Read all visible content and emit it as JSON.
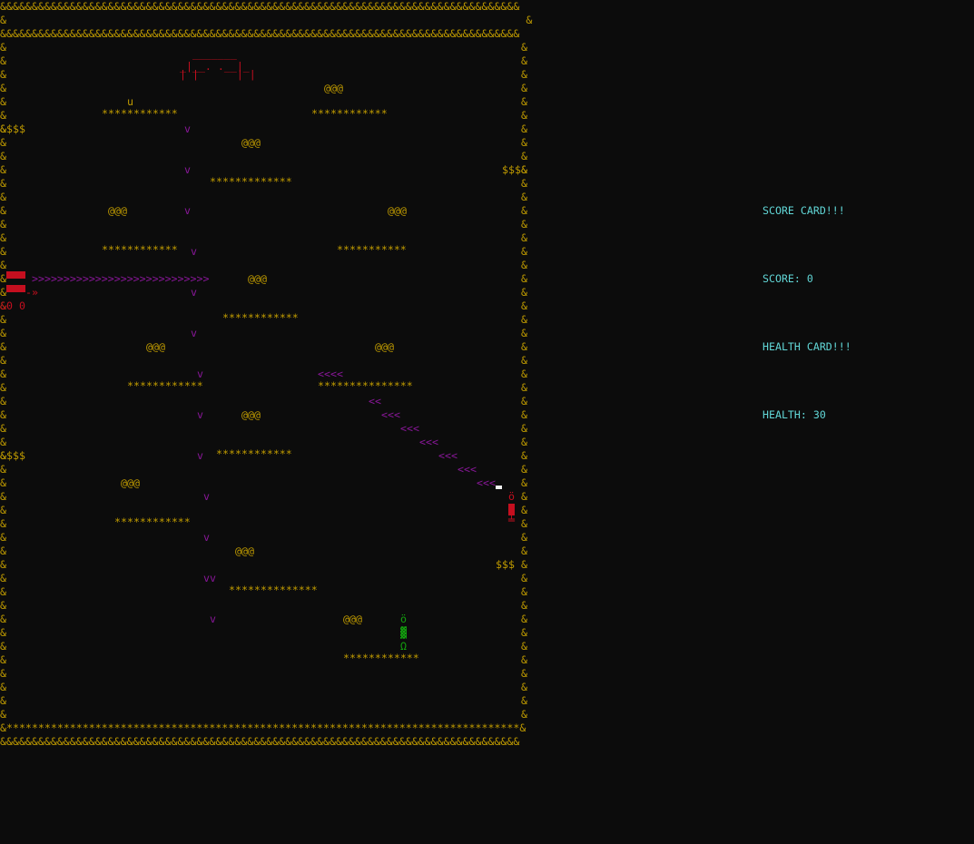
{
  "board": {
    "border_top_1": "&&&&&&&&&&&&&&&&&&&&&&&&&&&&&&&&&&&&&&&&&&&&&&&&&&&&&&&&&&&&&&&&&&&&&&&&&&&&&&&&&&",
    "border_top_2": "&                                                                                  &",
    "border_top_3": "&&&&&&&&&&&&&&&&&&&&&&&&&&&&&&&&&&&&&&&&&&&&&&&&&&&&&&&&&&&&&&&&&&&&&&&&&&&&&&&&&&",
    "floor": "&*********************************************************************************&",
    "border_bottom": "&&&&&&&&&&&&&&&&&&&&&&&&&&&&&&&&&&&&&&&&&&&&&&&&&&&&&&&&&&&&&&&&&&&&&&&&&&&&&&&&&&",
    "side": "&",
    "boss_art": [
      "  _______",
      "_|__. .__|_",
      "| |      | |"
    ],
    "player_u": "u",
    "coin": "@@@",
    "money": "$$$",
    "money_left": "&$$$",
    "money_right": "$$$&",
    "money_mid": "$$$",
    "platform_12": "************",
    "platform_13": "*************",
    "platform_11": "***********",
    "platform_15": "***************",
    "platform_14": "**************",
    "arrow_down": "v",
    "arrow_down2": "vv",
    "arrow_right_row": ">>>>>>>>>>>>>>>>>>>>>>>>>>>>",
    "arrow_left_4": "<<<<",
    "arrow_left_2": "<<",
    "arrow_left_3": "<<<",
    "tank_tail": "-»",
    "tank_wheels": "&0 0",
    "enemy_head": "ö",
    "enemy_feet": "╧",
    "green_head": "ö",
    "green_body": "▓",
    "green_feet": "Ω"
  },
  "panel": {
    "score_title": "SCORE CARD!!!",
    "score_label": "SCORE: 0",
    "health_title": "HEALTH CARD!!!",
    "health_label": "HEALTH: 30"
  }
}
